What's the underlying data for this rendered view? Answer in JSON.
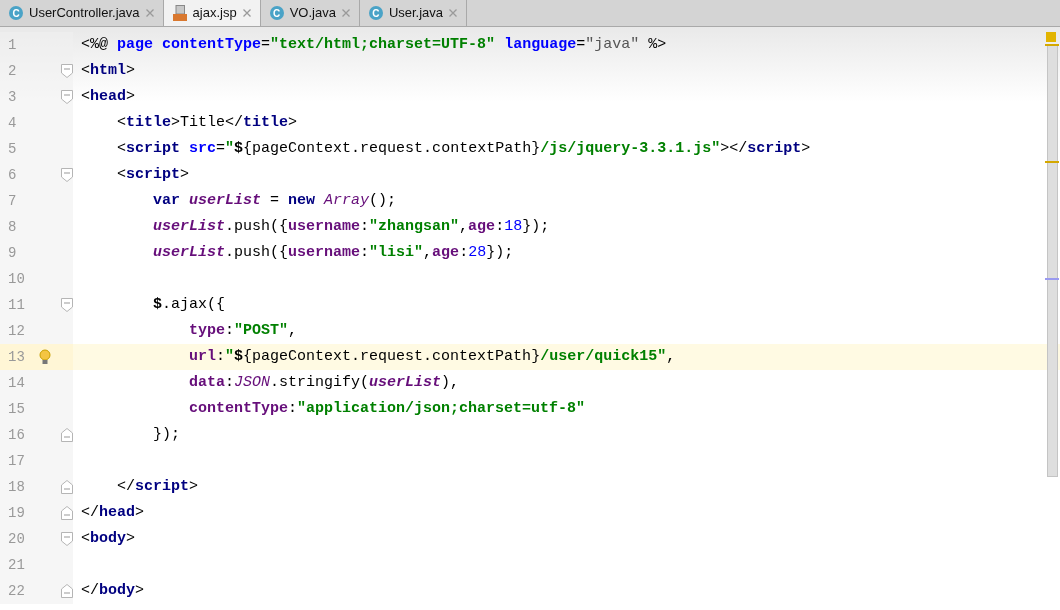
{
  "tabs": [
    {
      "label": "UserController.java",
      "kind": "class",
      "icon_text": "C",
      "selected": false
    },
    {
      "label": "ajax.jsp",
      "kind": "jsp",
      "selected": true
    },
    {
      "label": "VO.java",
      "kind": "class",
      "icon_text": "C",
      "selected": false
    },
    {
      "label": "User.java",
      "kind": "class",
      "icon_text": "C",
      "selected": false
    }
  ],
  "editor": {
    "lines": [
      {
        "number": "1",
        "fold_open": false,
        "fold_close": false,
        "current": false,
        "bulb": false,
        "tokens": [
          {
            "kind": "plain",
            "t": "<%@ "
          },
          {
            "kind": "attr",
            "t": "page "
          },
          {
            "kind": "attr",
            "t": "contentType"
          },
          {
            "kind": "plain",
            "t": "="
          },
          {
            "kind": "str",
            "t": "\"text/html;charset=UTF-8\" "
          },
          {
            "kind": "attr",
            "t": "language"
          },
          {
            "kind": "plain",
            "t": "="
          },
          {
            "kind": "val",
            "t": "\"java\""
          },
          {
            "kind": "plain",
            "t": " %>"
          }
        ]
      },
      {
        "number": "2",
        "fold_open": true,
        "fold_close": false,
        "current": false,
        "bulb": false,
        "tokens": [
          {
            "kind": "plain",
            "t": "<"
          },
          {
            "kind": "tag",
            "t": "html"
          },
          {
            "kind": "plain",
            "t": ">"
          }
        ]
      },
      {
        "number": "3",
        "fold_open": true,
        "fold_close": false,
        "current": false,
        "bulb": false,
        "tokens": [
          {
            "kind": "plain",
            "t": "<"
          },
          {
            "kind": "tag",
            "t": "head"
          },
          {
            "kind": "plain",
            "t": ">"
          }
        ]
      },
      {
        "number": "4",
        "fold_open": false,
        "fold_close": false,
        "current": false,
        "bulb": false,
        "tokens": [
          {
            "kind": "plain",
            "t": "    <"
          },
          {
            "kind": "tag",
            "t": "title"
          },
          {
            "kind": "plain",
            "t": ">Title</"
          },
          {
            "kind": "tag",
            "t": "title"
          },
          {
            "kind": "plain",
            "t": ">"
          }
        ]
      },
      {
        "number": "5",
        "fold_open": false,
        "fold_close": false,
        "current": false,
        "bulb": false,
        "tokens": [
          {
            "kind": "plain",
            "t": "    <"
          },
          {
            "kind": "tag",
            "t": "script "
          },
          {
            "kind": "attr",
            "t": "src"
          },
          {
            "kind": "plain",
            "t": "="
          },
          {
            "kind": "str",
            "t": "\""
          },
          {
            "kind": "bold",
            "t": "$"
          },
          {
            "kind": "plain",
            "t": "{pageContext.request.contextPath}"
          },
          {
            "kind": "str",
            "t": "/js/jquery-3.3.1.js\""
          },
          {
            "kind": "plain",
            "t": "></"
          },
          {
            "kind": "tag",
            "t": "script"
          },
          {
            "kind": "plain",
            "t": ">"
          }
        ]
      },
      {
        "number": "6",
        "fold_open": true,
        "fold_close": false,
        "current": false,
        "bulb": false,
        "tokens": [
          {
            "kind": "plain",
            "t": "    <"
          },
          {
            "kind": "tag",
            "t": "script"
          },
          {
            "kind": "plain",
            "t": ">"
          }
        ]
      },
      {
        "number": "7",
        "fold_open": false,
        "fold_close": false,
        "current": false,
        "bulb": false,
        "tokens": [
          {
            "kind": "kw",
            "t": "        var "
          },
          {
            "kind": "ivar",
            "t": "userList"
          },
          {
            "kind": "plain",
            "t": " = "
          },
          {
            "kind": "kw",
            "t": "new "
          },
          {
            "kind": "italic",
            "t": "Array"
          },
          {
            "kind": "plain",
            "t": "();"
          }
        ]
      },
      {
        "number": "8",
        "fold_open": false,
        "fold_close": false,
        "current": false,
        "bulb": false,
        "tokens": [
          {
            "kind": "ivar",
            "t": "        userList"
          },
          {
            "kind": "plain",
            "t": ".push({"
          },
          {
            "kind": "prop",
            "t": "username"
          },
          {
            "kind": "plain",
            "t": ":"
          },
          {
            "kind": "str",
            "t": "\"zhangsan\""
          },
          {
            "kind": "plain",
            "t": ","
          },
          {
            "kind": "prop",
            "t": "age"
          },
          {
            "kind": "plain",
            "t": ":"
          },
          {
            "kind": "num",
            "t": "18"
          },
          {
            "kind": "plain",
            "t": "});"
          }
        ]
      },
      {
        "number": "9",
        "fold_open": false,
        "fold_close": false,
        "current": false,
        "bulb": false,
        "tokens": [
          {
            "kind": "ivar",
            "t": "        userList"
          },
          {
            "kind": "plain",
            "t": ".push({"
          },
          {
            "kind": "prop",
            "t": "username"
          },
          {
            "kind": "plain",
            "t": ":"
          },
          {
            "kind": "str",
            "t": "\"lisi\""
          },
          {
            "kind": "plain",
            "t": ","
          },
          {
            "kind": "prop",
            "t": "age"
          },
          {
            "kind": "plain",
            "t": ":"
          },
          {
            "kind": "num",
            "t": "28"
          },
          {
            "kind": "plain",
            "t": "});"
          }
        ]
      },
      {
        "number": "10",
        "fold_open": false,
        "fold_close": false,
        "current": false,
        "bulb": false
      },
      {
        "number": "11",
        "fold_open": true,
        "fold_close": false,
        "current": false,
        "bulb": false,
        "tokens": [
          {
            "kind": "bold",
            "t": "        $"
          },
          {
            "kind": "plain",
            "t": ".ajax({"
          }
        ]
      },
      {
        "number": "12",
        "fold_open": false,
        "fold_close": false,
        "current": false,
        "bulb": false,
        "tokens": [
          {
            "kind": "prop",
            "t": "            type"
          },
          {
            "kind": "plain",
            "t": ":"
          },
          {
            "kind": "str",
            "t": "\"POST\""
          },
          {
            "kind": "plain",
            "t": ","
          }
        ]
      },
      {
        "number": "13",
        "fold_open": false,
        "fold_close": false,
        "current": true,
        "bulb": true,
        "tokens": [
          {
            "kind": "prop",
            "t": "            url"
          },
          {
            "kind": "plain",
            "t": ":"
          },
          {
            "kind": "str",
            "t": "\""
          },
          {
            "kind": "bold",
            "t": "$"
          },
          {
            "kind": "plain",
            "t": "{pageContext.request.contextPath}"
          },
          {
            "kind": "str",
            "t": "/user/quick15\""
          },
          {
            "kind": "plain",
            "t": ","
          }
        ]
      },
      {
        "number": "14",
        "fold_open": false,
        "fold_close": false,
        "current": false,
        "bulb": false,
        "tokens": [
          {
            "kind": "prop",
            "t": "            data"
          },
          {
            "kind": "plain",
            "t": ":"
          },
          {
            "kind": "italic",
            "t": "JSON"
          },
          {
            "kind": "plain",
            "t": ".stringify("
          },
          {
            "kind": "ivar",
            "t": "userList"
          },
          {
            "kind": "plain",
            "t": "),"
          }
        ]
      },
      {
        "number": "15",
        "fold_open": false,
        "fold_close": false,
        "current": false,
        "bulb": false,
        "tokens": [
          {
            "kind": "prop",
            "t": "            contentType"
          },
          {
            "kind": "plain",
            "t": ":"
          },
          {
            "kind": "str",
            "t": "\"application/json;charset=utf-8\""
          }
        ]
      },
      {
        "number": "16",
        "fold_open": false,
        "fold_close": true,
        "current": false,
        "bulb": false,
        "tokens": [
          {
            "kind": "plain",
            "t": "        });"
          }
        ]
      },
      {
        "number": "17",
        "fold_open": false,
        "fold_close": false,
        "current": false,
        "bulb": false
      },
      {
        "number": "18",
        "fold_open": false,
        "fold_close": true,
        "current": false,
        "bulb": false,
        "tokens": [
          {
            "kind": "plain",
            "t": "    </"
          },
          {
            "kind": "tag",
            "t": "script"
          },
          {
            "kind": "plain",
            "t": ">"
          }
        ]
      },
      {
        "number": "19",
        "fold_open": false,
        "fold_close": true,
        "current": false,
        "bulb": false,
        "tokens": [
          {
            "kind": "plain",
            "t": "</"
          },
          {
            "kind": "tag",
            "t": "head"
          },
          {
            "kind": "plain",
            "t": ">"
          }
        ]
      },
      {
        "number": "20",
        "fold_open": true,
        "fold_close": false,
        "current": false,
        "bulb": false,
        "tokens": [
          {
            "kind": "plain",
            "t": "<"
          },
          {
            "kind": "tag",
            "t": "body"
          },
          {
            "kind": "plain",
            "t": ">"
          }
        ]
      },
      {
        "number": "21",
        "fold_open": false,
        "fold_close": false,
        "current": false,
        "bulb": false
      },
      {
        "number": "22",
        "fold_open": false,
        "fold_close": true,
        "current": false,
        "bulb": false,
        "tokens": [
          {
            "kind": "plain",
            "t": "</"
          },
          {
            "kind": "tag",
            "t": "body"
          },
          {
            "kind": "plain",
            "t": ">"
          }
        ]
      }
    ]
  }
}
